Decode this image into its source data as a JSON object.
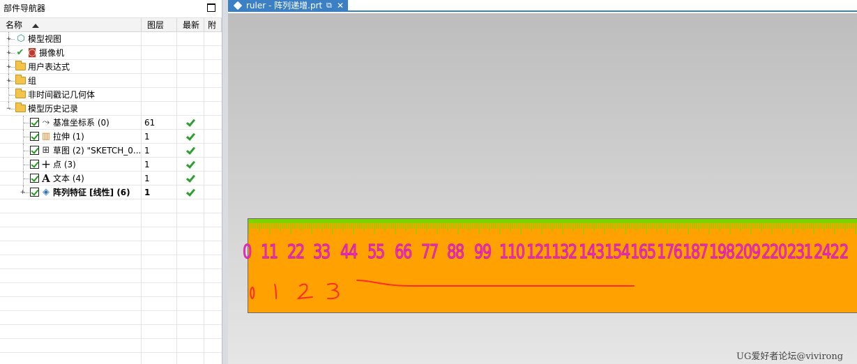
{
  "navigator": {
    "title": "部件导航器",
    "columns": [
      "名称",
      "图层",
      "最新",
      "附"
    ],
    "rows": [
      {
        "label": "模型视图",
        "layer": "",
        "latest": false,
        "level": 0,
        "expander": "+",
        "icon": "model-views-icon",
        "bold": false,
        "checkbox": false
      },
      {
        "label": "摄像机",
        "layer": "",
        "latest": false,
        "level": 0,
        "expander": "+",
        "icon": "camera-icon",
        "bold": false,
        "checkbox": false,
        "prefix_check": true
      },
      {
        "label": "用户表达式",
        "layer": "",
        "latest": false,
        "level": 0,
        "expander": "+",
        "icon": "folder-icon",
        "bold": false,
        "checkbox": false
      },
      {
        "label": "组",
        "layer": "",
        "latest": false,
        "level": 0,
        "expander": "+",
        "icon": "folder-icon",
        "bold": false,
        "checkbox": false
      },
      {
        "label": "非时间戳记几何体",
        "layer": "",
        "latest": false,
        "level": 0,
        "expander": "",
        "icon": "folder-icon",
        "bold": false,
        "checkbox": false
      },
      {
        "label": "模型历史记录",
        "layer": "",
        "latest": false,
        "level": 0,
        "expander": "−",
        "icon": "folder-icon",
        "bold": false,
        "checkbox": false
      },
      {
        "label": "基准坐标系 (0)",
        "layer": "61",
        "latest": true,
        "level": 1,
        "expander": "",
        "icon": "datum-csys-icon",
        "bold": false,
        "checkbox": true
      },
      {
        "label": "拉伸 (1)",
        "layer": "1",
        "latest": true,
        "level": 1,
        "expander": "",
        "icon": "extrude-icon",
        "bold": false,
        "checkbox": true
      },
      {
        "label": "草图 (2) \"SKETCH_0...",
        "layer": "1",
        "latest": true,
        "level": 1,
        "expander": "",
        "icon": "sketch-icon",
        "bold": false,
        "checkbox": true
      },
      {
        "label": "点 (3)",
        "layer": "1",
        "latest": true,
        "level": 1,
        "expander": "",
        "icon": "point-icon",
        "bold": false,
        "checkbox": true
      },
      {
        "label": "文本 (4)",
        "layer": "1",
        "latest": true,
        "level": 1,
        "expander": "",
        "icon": "text-icon",
        "bold": false,
        "checkbox": true
      },
      {
        "label": "阵列特征 [线性] (6)",
        "layer": "1",
        "latest": true,
        "level": 1,
        "expander": "+",
        "icon": "pattern-feature-icon",
        "bold": true,
        "checkbox": true
      }
    ]
  },
  "document_tab": {
    "title": "ruler - 阵列递增.prt",
    "popout_icon": "popout-icon",
    "close_icon": "close-icon"
  },
  "ruler": {
    "number_labels": [
      "0",
      "11",
      "22",
      "33",
      "44",
      "55",
      "66",
      "77",
      "88",
      "99",
      "110",
      "121",
      "132",
      "143",
      "154",
      "165",
      "176",
      "187",
      "198",
      "209",
      "220",
      "231",
      "242",
      "2"
    ],
    "handwritten_labels": [
      "0",
      "1",
      "2",
      "3"
    ],
    "body_color": "#ffa100",
    "tick_color": "#7fd400",
    "number_color": "#ff2bd0",
    "sketch_line_color": "#ff2a2a"
  },
  "watermark": "UG爱好者论坛@vivirong"
}
